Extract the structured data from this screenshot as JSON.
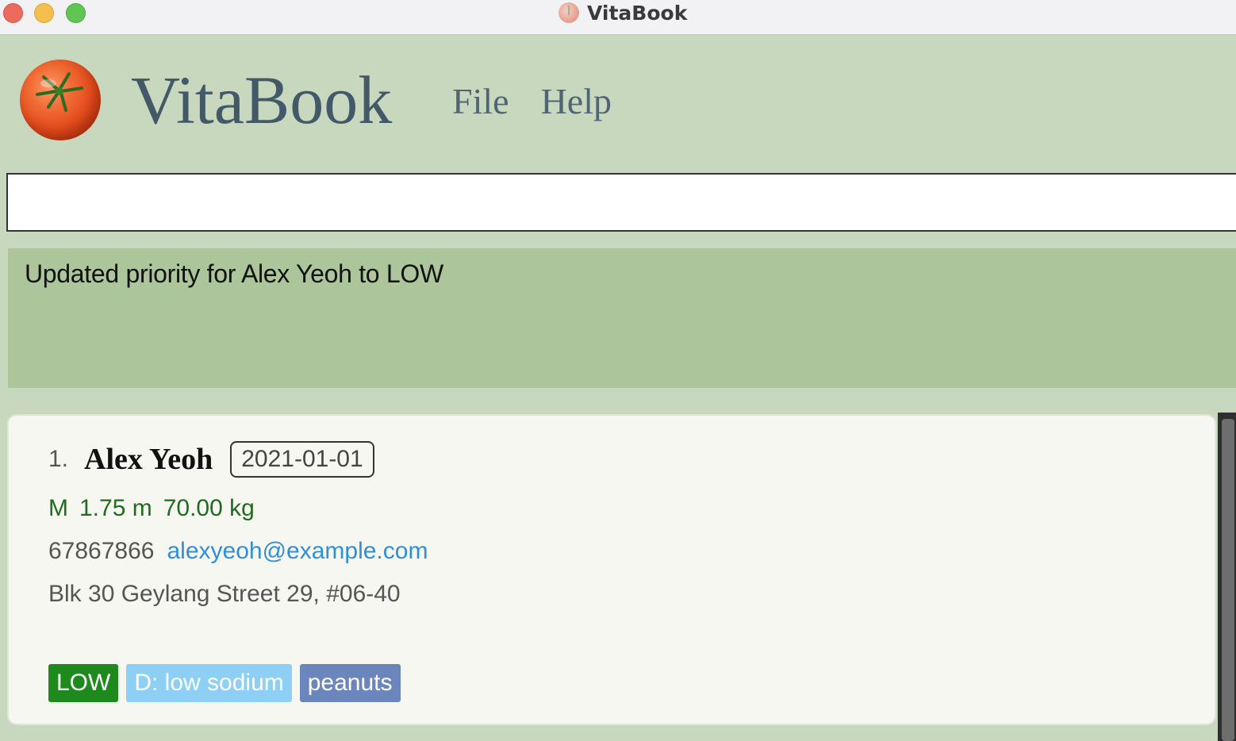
{
  "window": {
    "title": "VitaBook"
  },
  "header": {
    "app_name": "VitaBook",
    "menu": [
      {
        "label": "File"
      },
      {
        "label": "Help"
      }
    ]
  },
  "command_box": {
    "value": "",
    "placeholder": ""
  },
  "result_display": {
    "message": "Updated priority for Alex Yeoh to LOW"
  },
  "patients": [
    {
      "index": "1.",
      "name": "Alex Yeoh",
      "date": "2021-01-01",
      "gender": "M",
      "height": "1.75 m",
      "weight": "70.00 kg",
      "phone": "67867866",
      "email": "alexyeoh@example.com",
      "address": "Blk 30 Geylang Street 29, #06-40",
      "tags": [
        {
          "label": "LOW",
          "color": "#1e8a1e"
        },
        {
          "label": "D: low sodium",
          "color": "#8ecff5"
        },
        {
          "label": "peanuts",
          "color": "#6b86bd"
        }
      ]
    }
  ],
  "colors": {
    "background": "#c7d8bf",
    "result_box": "#adc59a",
    "title_text": "#435967",
    "vitals_text": "#1f6b1f",
    "email_link": "#2e8fd8"
  }
}
